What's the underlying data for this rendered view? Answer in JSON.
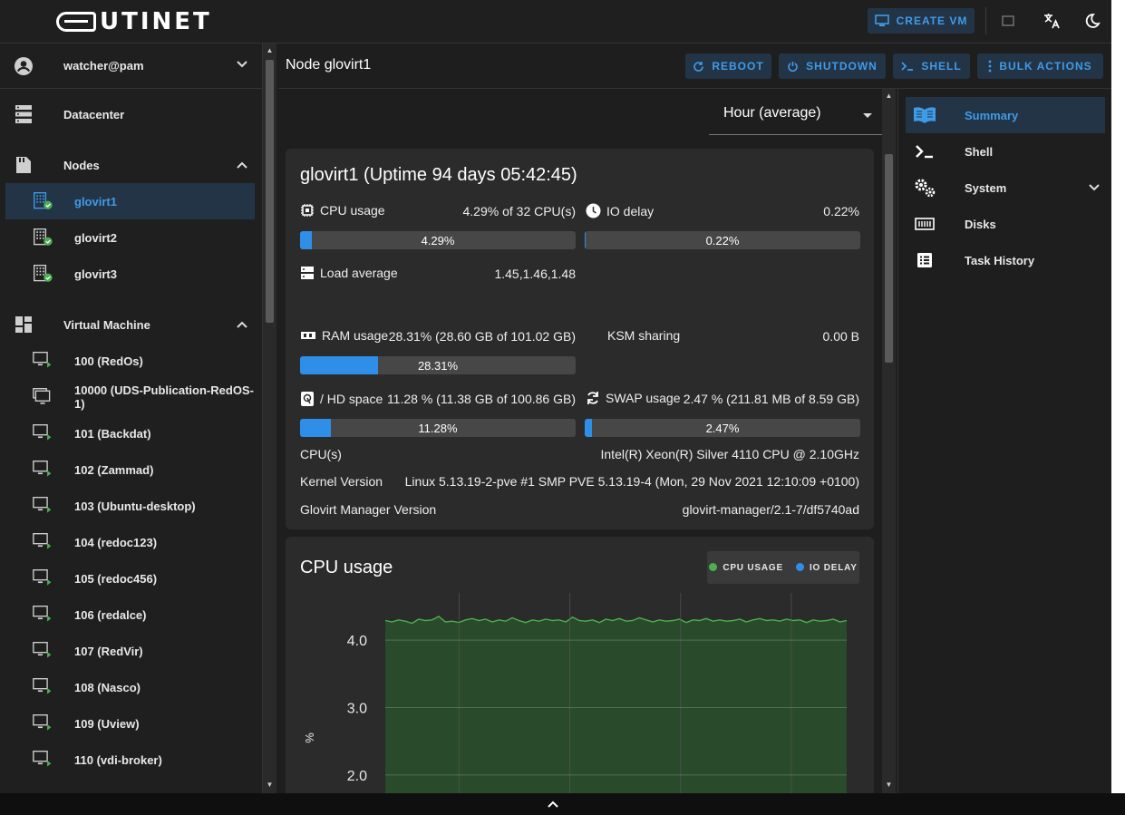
{
  "app": {
    "logo_text": "UTINET",
    "create_vm_label": "CREATE VM"
  },
  "sidebar": {
    "user": "watcher@pam",
    "datacenter": "Datacenter",
    "nodes_label": "Nodes",
    "nodes": [
      {
        "label": "glovirt1",
        "selected": true
      },
      {
        "label": "glovirt2"
      },
      {
        "label": "glovirt3"
      }
    ],
    "vm_label": "Virtual Machine",
    "vms": [
      "100 (RedOs)",
      "10000 (UDS-Publication-RedOS-1)",
      "101 (Backdat)",
      "102 (Zammad)",
      "103 (Ubuntu-desktop)",
      "104 (redoc123)",
      "105 (redoc456)",
      "106 (redalce)",
      "107 (RedVir)",
      "108 (Nasco)",
      "109 (Uview)",
      "110 (vdi-broker)"
    ]
  },
  "header": {
    "title": "Node glovirt1",
    "reboot": "REBOOT",
    "shutdown": "SHUTDOWN",
    "shell": "SHELL",
    "bulk": "BULK ACTIONS"
  },
  "timeframe": {
    "selected": "Hour (average)"
  },
  "summary": {
    "title": "glovirt1 (Uptime 94 days 05:42:45)",
    "cpu_label": "CPU usage",
    "cpu_value": "4.29% of 32 CPU(s)",
    "cpu_bar": "4.29%",
    "cpu_pct": 4.29,
    "io_label": "IO delay",
    "io_value": "0.22%",
    "io_bar": "0.22%",
    "io_pct": 0.22,
    "load_label": "Load average",
    "load_value": "1.45,1.46,1.48",
    "ram_label": "RAM usage",
    "ram_value": "28.31% (28.60 GB of 101.02 GB)",
    "ram_bar": "28.31%",
    "ram_pct": 28.31,
    "ksm_label": "KSM sharing",
    "ksm_value": "0.00 B",
    "hd_label": "/ HD space",
    "hd_value": "11.28 % (11.38 GB of 100.86 GB)",
    "hd_bar": "11.28%",
    "hd_pct": 11.28,
    "swap_label": "SWAP usage",
    "swap_value": "2.47 % (211.81 MB of 8.59 GB)",
    "swap_bar": "2.47%",
    "swap_pct": 2.47,
    "cpus_label": "CPU(s)",
    "cpus_value": "Intel(R) Xeon(R) Silver 4110 CPU @ 2.10GHz",
    "kernel_label": "Kernel Version",
    "kernel_value": "Linux 5.13.19-2-pve #1 SMP PVE 5.13.19-4 (Mon, 29 Nov 2021 12:10:09 +0100)",
    "manager_label": "Glovirt Manager Version",
    "manager_value": "glovirt-manager/2.1-7/df5740ad"
  },
  "chart_data": {
    "type": "area",
    "title": "CPU usage",
    "ylabel": "%",
    "xlabel": "",
    "ylim": [
      1.5,
      4.7
    ],
    "yticks": [
      "4.0",
      "3.0",
      "2.0"
    ],
    "grid": true,
    "legend_position": "top-right",
    "series": [
      {
        "name": "CPU USAGE",
        "color": "#4caf50",
        "values": [
          4.29,
          4.27,
          4.3,
          4.28,
          4.25,
          4.31,
          4.29,
          4.3,
          4.35,
          4.27,
          4.28,
          4.26,
          4.3,
          4.32,
          4.29,
          4.31,
          4.27,
          4.3,
          4.28,
          4.33,
          4.29,
          4.26,
          4.3,
          4.28,
          4.31,
          4.29,
          4.3,
          4.27,
          4.34,
          4.29,
          4.28,
          4.3,
          4.26,
          4.31,
          4.29,
          4.32,
          4.28,
          4.29,
          4.33,
          4.3,
          4.27,
          4.3,
          4.28,
          4.29,
          4.31,
          4.26,
          4.3,
          4.29,
          4.32,
          4.28,
          4.3,
          4.28,
          4.29,
          4.31,
          4.27,
          4.3,
          4.32,
          4.29,
          4.3,
          4.28,
          4.31,
          4.29,
          4.3,
          4.26,
          4.3,
          4.28,
          4.29,
          4.31,
          4.27,
          4.29
        ]
      },
      {
        "name": "IO DELAY",
        "color": "#2f8fe8",
        "values": []
      }
    ]
  },
  "right_panel": {
    "items": [
      {
        "label": "Summary",
        "active": true
      },
      {
        "label": "Shell"
      },
      {
        "label": "System"
      },
      {
        "label": "Disks"
      },
      {
        "label": "Task History"
      }
    ]
  }
}
